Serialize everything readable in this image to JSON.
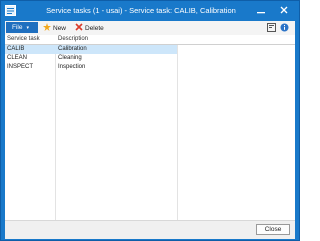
{
  "window": {
    "title": "Service tasks (1 - usai) - Service task: CALIB, Calibration"
  },
  "toolbar": {
    "file_label": "File",
    "new_label": "New",
    "delete_label": "Delete"
  },
  "grid": {
    "columns": [
      "Service task",
      "Description"
    ],
    "rows": [
      {
        "service_task": "CALIB",
        "description": "Calibration",
        "selected": true
      },
      {
        "service_task": "CLEAN",
        "description": "Cleaning",
        "selected": false
      },
      {
        "service_task": "INSPECT",
        "description": "Inspection",
        "selected": false
      }
    ]
  },
  "footer": {
    "close_label": "Close"
  },
  "colors": {
    "title_bar": "#1979ca",
    "file_button": "#1f6fbf",
    "selected_row": "#cde6fa"
  },
  "icons": {
    "app": "form-app-icon",
    "new": "new-star-icon",
    "delete": "delete-x-icon",
    "help": "help-icon",
    "info": "info-icon",
    "minimize": "minimize-icon",
    "close": "close-icon"
  }
}
